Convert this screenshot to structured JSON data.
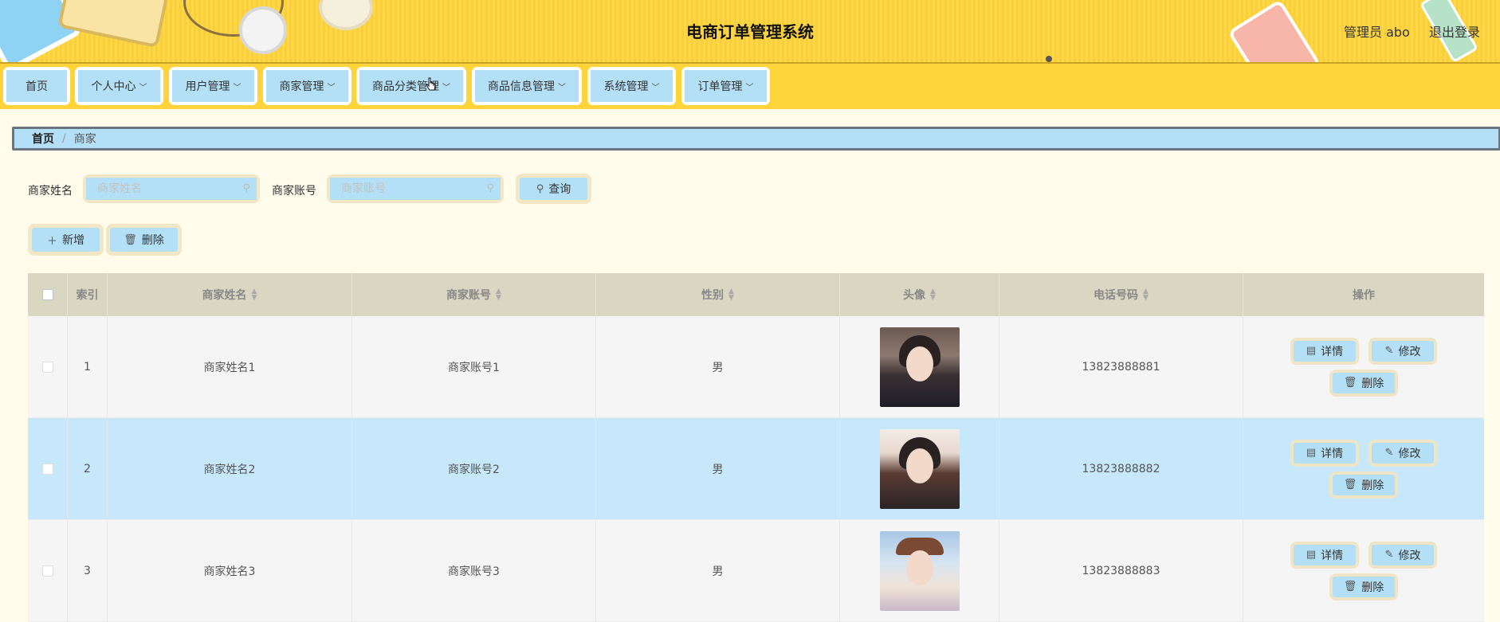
{
  "header": {
    "title": "电商订单管理系统",
    "admin_label": "管理员 abo",
    "logout_label": "退出登录"
  },
  "nav": {
    "items": [
      {
        "label": "首页",
        "has_dropdown": false
      },
      {
        "label": "个人中心",
        "has_dropdown": true
      },
      {
        "label": "用户管理",
        "has_dropdown": true
      },
      {
        "label": "商家管理",
        "has_dropdown": true
      },
      {
        "label": "商品分类管理",
        "has_dropdown": true
      },
      {
        "label": "商品信息管理",
        "has_dropdown": true
      },
      {
        "label": "系统管理",
        "has_dropdown": true
      },
      {
        "label": "订单管理",
        "has_dropdown": true
      }
    ]
  },
  "breadcrumb": {
    "home": "首页",
    "separator": "/",
    "current": "商家"
  },
  "search": {
    "name_label": "商家姓名",
    "name_placeholder": "商家姓名",
    "name_value": "",
    "account_label": "商家账号",
    "account_placeholder": "商家账号",
    "account_value": "",
    "query_label": "查询"
  },
  "actions": {
    "add_label": "新增",
    "delete_label": "删除"
  },
  "table": {
    "columns": {
      "index": "索引",
      "name": "商家姓名",
      "account": "商家账号",
      "gender": "性别",
      "avatar": "头像",
      "phone": "电话号码",
      "ops": "操作"
    },
    "rows": [
      {
        "index": "1",
        "name": "商家姓名1",
        "account": "商家账号1",
        "gender": "男",
        "phone": "13823888881"
      },
      {
        "index": "2",
        "name": "商家姓名2",
        "account": "商家账号2",
        "gender": "男",
        "phone": "13823888882"
      },
      {
        "index": "3",
        "name": "商家姓名3",
        "account": "商家账号3",
        "gender": "男",
        "phone": "13823888883"
      }
    ],
    "row_ops": {
      "detail": "详情",
      "edit": "修改",
      "delete": "删除"
    }
  },
  "colors": {
    "header_bg": "#ffd43b",
    "button_bg": "#b3e0f7",
    "button_border": "#f2e6c5",
    "table_head_bg": "#d9d6c1",
    "row_highlight": "#c6e8fa",
    "page_bg": "#fffcec"
  },
  "icons": {
    "search": "search-icon",
    "add": "plus-icon",
    "delete": "trash-icon",
    "detail": "document-icon",
    "edit": "pencil-icon",
    "dropdown": "chevron-down-icon",
    "sort": "sort-icon"
  }
}
